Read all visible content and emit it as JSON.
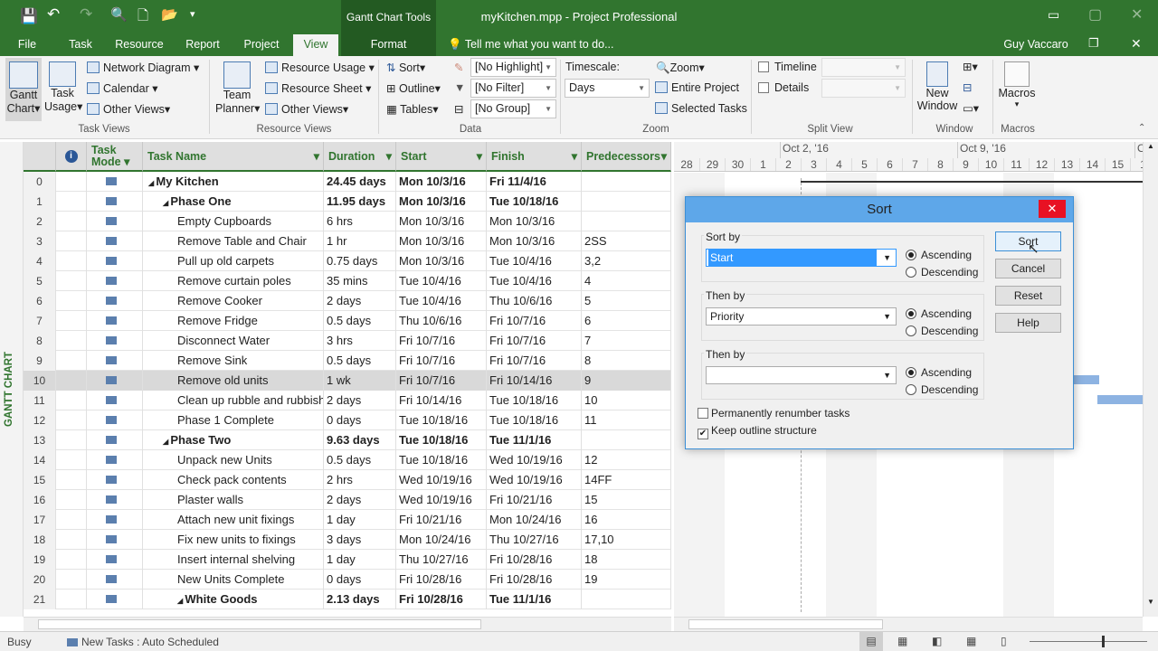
{
  "title_bar": {
    "context_tab": "Gantt Chart Tools",
    "title": "myKitchen.mpp - Project Professional"
  },
  "tabs": [
    "File",
    "Task",
    "Resource",
    "Report",
    "Project",
    "View",
    "Format"
  ],
  "active_tab": "View",
  "tell_me": "Tell me what you want to do...",
  "user": "Guy Vaccaro",
  "ribbon": {
    "task_views": {
      "gantt": "Gantt",
      "gantt2": "Chart",
      "task_usage": "Task",
      "task_usage2": "Usage",
      "network": "Network Diagram",
      "calendar": "Calendar",
      "other": "Other Views",
      "label": "Task Views"
    },
    "resource_views": {
      "team": "Team",
      "team2": "Planner",
      "usage": "Resource Usage",
      "sheet": "Resource Sheet",
      "other": "Other Views",
      "label": "Resource Views"
    },
    "data": {
      "sort": "Sort",
      "outline": "Outline",
      "tables": "Tables",
      "highlight": "[No Highlight]",
      "filter": "[No Filter]",
      "group": "[No Group]",
      "label": "Data"
    },
    "zoom": {
      "timescale_label": "Timescale:",
      "timescale": "Days",
      "zoom": "Zoom",
      "entire": "Entire Project",
      "selected": "Selected Tasks",
      "label": "Zoom"
    },
    "split": {
      "timeline": "Timeline",
      "details": "Details",
      "label": "Split View"
    },
    "window": {
      "new": "New",
      "new2": "Window",
      "label": "Window"
    },
    "macros": {
      "macros": "Macros",
      "label": "Macros"
    }
  },
  "side_label": "GANTT CHART",
  "columns": [
    "Task Mode",
    "Task Name",
    "Duration",
    "Start",
    "Finish",
    "Predecessors"
  ],
  "rows": [
    [
      "0",
      "My Kitchen",
      "24.45 days",
      "Mon 10/3/16",
      "Fri 11/4/16",
      "",
      0,
      true
    ],
    [
      "1",
      "Phase One",
      "11.95 days",
      "Mon 10/3/16",
      "Tue 10/18/16",
      "",
      1,
      true
    ],
    [
      "2",
      "Empty Cupboards",
      "6 hrs",
      "Mon 10/3/16",
      "Mon 10/3/16",
      "",
      2,
      false
    ],
    [
      "3",
      "Remove Table and Chair",
      "1 hr",
      "Mon 10/3/16",
      "Mon 10/3/16",
      "2SS",
      2,
      false
    ],
    [
      "4",
      "Pull up old carpets",
      "0.75 days",
      "Mon 10/3/16",
      "Tue 10/4/16",
      "3,2",
      2,
      false
    ],
    [
      "5",
      "Remove curtain poles",
      "35 mins",
      "Tue 10/4/16",
      "Tue 10/4/16",
      "4",
      2,
      false
    ],
    [
      "6",
      "Remove Cooker",
      "2 days",
      "Tue 10/4/16",
      "Thu 10/6/16",
      "5",
      2,
      false
    ],
    [
      "7",
      "Remove Fridge",
      "0.5 days",
      "Thu 10/6/16",
      "Fri 10/7/16",
      "6",
      2,
      false
    ],
    [
      "8",
      "Disconnect Water",
      "3 hrs",
      "Fri 10/7/16",
      "Fri 10/7/16",
      "7",
      2,
      false
    ],
    [
      "9",
      "Remove Sink",
      "0.5 days",
      "Fri 10/7/16",
      "Fri 10/7/16",
      "8",
      2,
      false
    ],
    [
      "10",
      "Remove old units",
      "1 wk",
      "Fri 10/7/16",
      "Fri 10/14/16",
      "9",
      2,
      false
    ],
    [
      "11",
      "Clean up rubble and rubbish",
      "2 days",
      "Fri 10/14/16",
      "Tue 10/18/16",
      "10",
      2,
      false
    ],
    [
      "12",
      "Phase 1 Complete",
      "0 days",
      "Tue 10/18/16",
      "Tue 10/18/16",
      "11",
      2,
      false
    ],
    [
      "13",
      "Phase Two",
      "9.63 days",
      "Tue 10/18/16",
      "Tue 11/1/16",
      "",
      1,
      true
    ],
    [
      "14",
      "Unpack new Units",
      "0.5 days",
      "Tue 10/18/16",
      "Wed 10/19/16",
      "12",
      2,
      false
    ],
    [
      "15",
      "Check pack contents",
      "2 hrs",
      "Wed 10/19/16",
      "Wed 10/19/16",
      "14FF",
      2,
      false
    ],
    [
      "16",
      "Plaster walls",
      "2 days",
      "Wed 10/19/16",
      "Fri 10/21/16",
      "15",
      2,
      false
    ],
    [
      "17",
      "Attach new unit fixings",
      "1 day",
      "Fri 10/21/16",
      "Mon 10/24/16",
      "16",
      2,
      false
    ],
    [
      "18",
      "Fix new units to fixings",
      "3 days",
      "Mon 10/24/16",
      "Thu 10/27/16",
      "17,10",
      2,
      false
    ],
    [
      "19",
      "Insert internal shelving",
      "1 day",
      "Thu 10/27/16",
      "Fri 10/28/16",
      "18",
      2,
      false
    ],
    [
      "20",
      "New Units Complete",
      "0 days",
      "Fri 10/28/16",
      "Fri 10/28/16",
      "19",
      2,
      false
    ],
    [
      "21",
      "White Goods",
      "2.13 days",
      "Fri 10/28/16",
      "Tue 11/1/16",
      "",
      2,
      true
    ]
  ],
  "selected_row": "10",
  "timescale": {
    "weeks": [
      "Oct 2, '16",
      "Oct 9, '16",
      "O"
    ],
    "days": [
      "28",
      "29",
      "30",
      "1",
      "2",
      "3",
      "4",
      "5",
      "6",
      "7",
      "8",
      "9",
      "10",
      "11",
      "12",
      "13",
      "14",
      "15",
      "1"
    ]
  },
  "dialog": {
    "title": "Sort",
    "sort_by": {
      "label": "Sort by",
      "value": "Start",
      "order": "Ascending"
    },
    "then_by1": {
      "label": "Then by",
      "value": "Priority",
      "order": "Ascending"
    },
    "then_by2": {
      "label": "Then by",
      "value": "",
      "order": "Ascending"
    },
    "ascending": "Ascending",
    "descending": "Descending",
    "renumber": {
      "label": "Permanently renumber tasks",
      "checked": false
    },
    "keep_outline": {
      "label": "Keep outline structure",
      "checked": true
    },
    "buttons": {
      "sort": "Sort",
      "cancel": "Cancel",
      "reset": "Reset",
      "help": "Help"
    }
  },
  "status": {
    "state": "Busy",
    "new_tasks": "New Tasks : Auto Scheduled"
  },
  "colors": {
    "brand": "#31752f",
    "dialog_title": "#5ea7e9",
    "selection": "#3399ff"
  }
}
